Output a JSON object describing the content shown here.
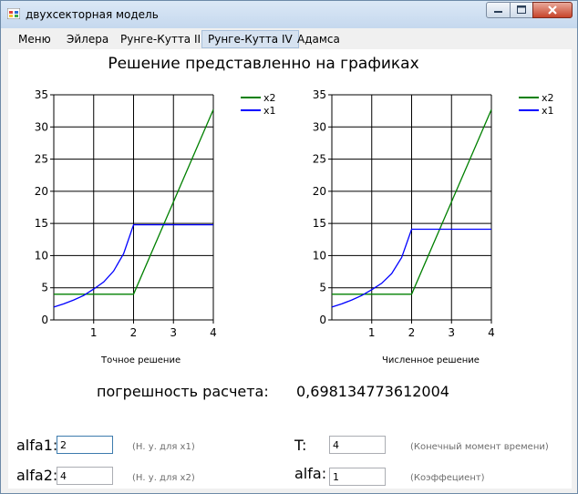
{
  "window": {
    "title": "двухсекторная модель"
  },
  "menu": [
    "Меню",
    "Эйлера",
    "Рунге-Кутта III",
    "Рунге-Кутта IV",
    "Адамса"
  ],
  "menu_active": 3,
  "heading": "Решение представленно на графиках",
  "charts": {
    "left_caption": "Точное решение",
    "right_caption": "Численное решение"
  },
  "chart_data": [
    {
      "type": "line",
      "title": "",
      "caption": "Точное решение",
      "xlim": [
        0,
        4
      ],
      "ylim": [
        0,
        35
      ],
      "xticks": [
        1,
        2,
        3,
        4
      ],
      "yticks": [
        0,
        5,
        10,
        15,
        20,
        25,
        30,
        35
      ],
      "grid": true,
      "legend_position": "top-right",
      "series": [
        {
          "name": "x2",
          "color": "#008000",
          "points": [
            [
              0,
              4
            ],
            [
              2,
              4
            ],
            [
              4,
              32.7
            ]
          ]
        },
        {
          "name": "x1",
          "color": "#0000ff",
          "points": [
            [
              0,
              2
            ],
            [
              0.25,
              2.5
            ],
            [
              0.5,
              3.1
            ],
            [
              0.75,
              3.8
            ],
            [
              1,
              4.8
            ],
            [
              1.25,
              5.9
            ],
            [
              1.5,
              7.6
            ],
            [
              1.75,
              10.3
            ],
            [
              2,
              14.8
            ],
            [
              4,
              14.8
            ]
          ]
        }
      ]
    },
    {
      "type": "line",
      "title": "",
      "caption": "Численное решение",
      "xlim": [
        0,
        4
      ],
      "ylim": [
        0,
        35
      ],
      "xticks": [
        1,
        2,
        3,
        4
      ],
      "yticks": [
        0,
        5,
        10,
        15,
        20,
        25,
        30,
        35
      ],
      "grid": true,
      "legend_position": "top-right",
      "series": [
        {
          "name": "x2",
          "color": "#008000",
          "points": [
            [
              0,
              4
            ],
            [
              2,
              4
            ],
            [
              4,
              32.7
            ]
          ]
        },
        {
          "name": "x1",
          "color": "#0000ff",
          "points": [
            [
              0,
              2
            ],
            [
              0.25,
              2.5
            ],
            [
              0.5,
              3.1
            ],
            [
              0.75,
              3.8
            ],
            [
              1,
              4.7
            ],
            [
              1.25,
              5.7
            ],
            [
              1.5,
              7.2
            ],
            [
              1.75,
              9.7
            ],
            [
              2,
              14.1
            ],
            [
              4,
              14.1
            ]
          ]
        }
      ]
    }
  ],
  "error": {
    "label": "погрешность расчета:",
    "value": "0,698134773612004"
  },
  "params": {
    "alfa1": {
      "label": "alfa1:",
      "value": "2",
      "hint": "(Н. у. для x1)"
    },
    "alfa2": {
      "label": "alfa2:",
      "value": "4",
      "hint": "(Н. у. для x2)"
    },
    "T": {
      "label": "T:",
      "value": "4",
      "hint": "(Конечный момент времени)"
    },
    "alfa": {
      "label": "alfa:",
      "value": "1",
      "hint": "(Коэффециент)"
    }
  }
}
